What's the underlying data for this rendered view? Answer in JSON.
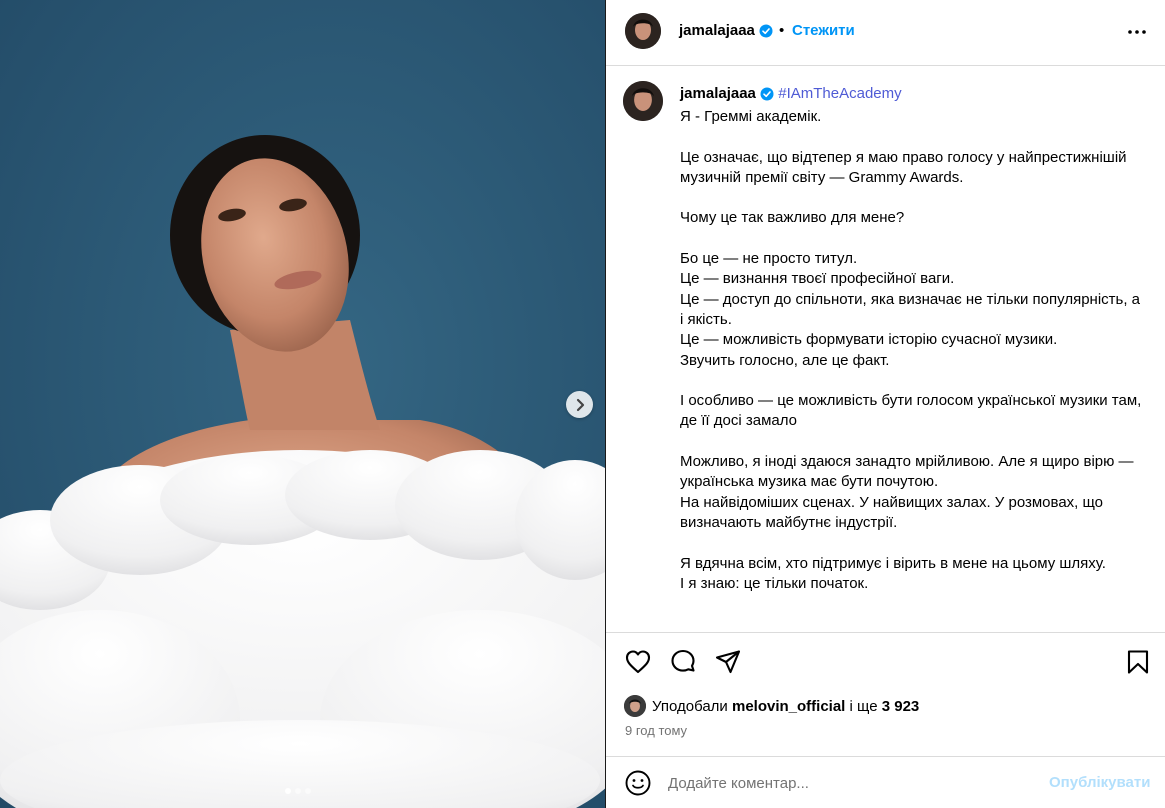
{
  "post": {
    "username": "jamalajaaa",
    "follow_label": "Стежити",
    "follow_separator": "•",
    "caption_hashtag": "#IAmTheAcademy",
    "caption_text": "Я - Греммі академік.\n\nЦе означає, що відтепер я маю право голосу у найпрестижнішій музичній премії світу — Grammy Awards.\n\nЧому це так важливо для мене?\n\nБо це — не просто титул.\nЦе — визнання твоєї професійної ваги.\nЦе — доступ до спільноти, яка визначає не тільки популярність, а і якість.\nЦе — можливість формувати історію сучасної музики.\nЗвучить голосно, але це факт.\n\nІ особливо — це можливість бути голосом української музики там, де її досі замало\n\nМожливо, я іноді здаюся занадто мрійливою. Але я щиро вірю —\nукраїнська музика має бути почутою.\nНа найвідоміших сценах. У найвищих залах. У розмовах, що визначають майбутнє індустрії.\n\nЯ вдячна всім, хто підтримує і вірить в мене на цьому шляху.\nІ я знаю: це тільки початок.",
    "likes_prefix": "Уподобали",
    "likes_user": "melovin_official",
    "likes_middle": "і ще",
    "likes_count": "3 923",
    "timestamp": "9 год тому",
    "carousel": {
      "total": 3,
      "active": 1
    }
  },
  "comment": {
    "placeholder": "Додайте коментар...",
    "post_label": "Опублікувати"
  },
  "colors": {
    "accent": "#0095f6",
    "hashtag": "#4f5bd5",
    "verified": "#0095f6",
    "post_disabled": "#b2dffc",
    "photo_background": "#2b5877"
  },
  "icons": {
    "verified": "verified-badge-icon",
    "more": "more-options-icon",
    "next": "chevron-right-icon",
    "like": "heart-icon",
    "comment": "comment-icon",
    "share": "send-icon",
    "save": "bookmark-icon",
    "emoji": "emoji-icon"
  }
}
